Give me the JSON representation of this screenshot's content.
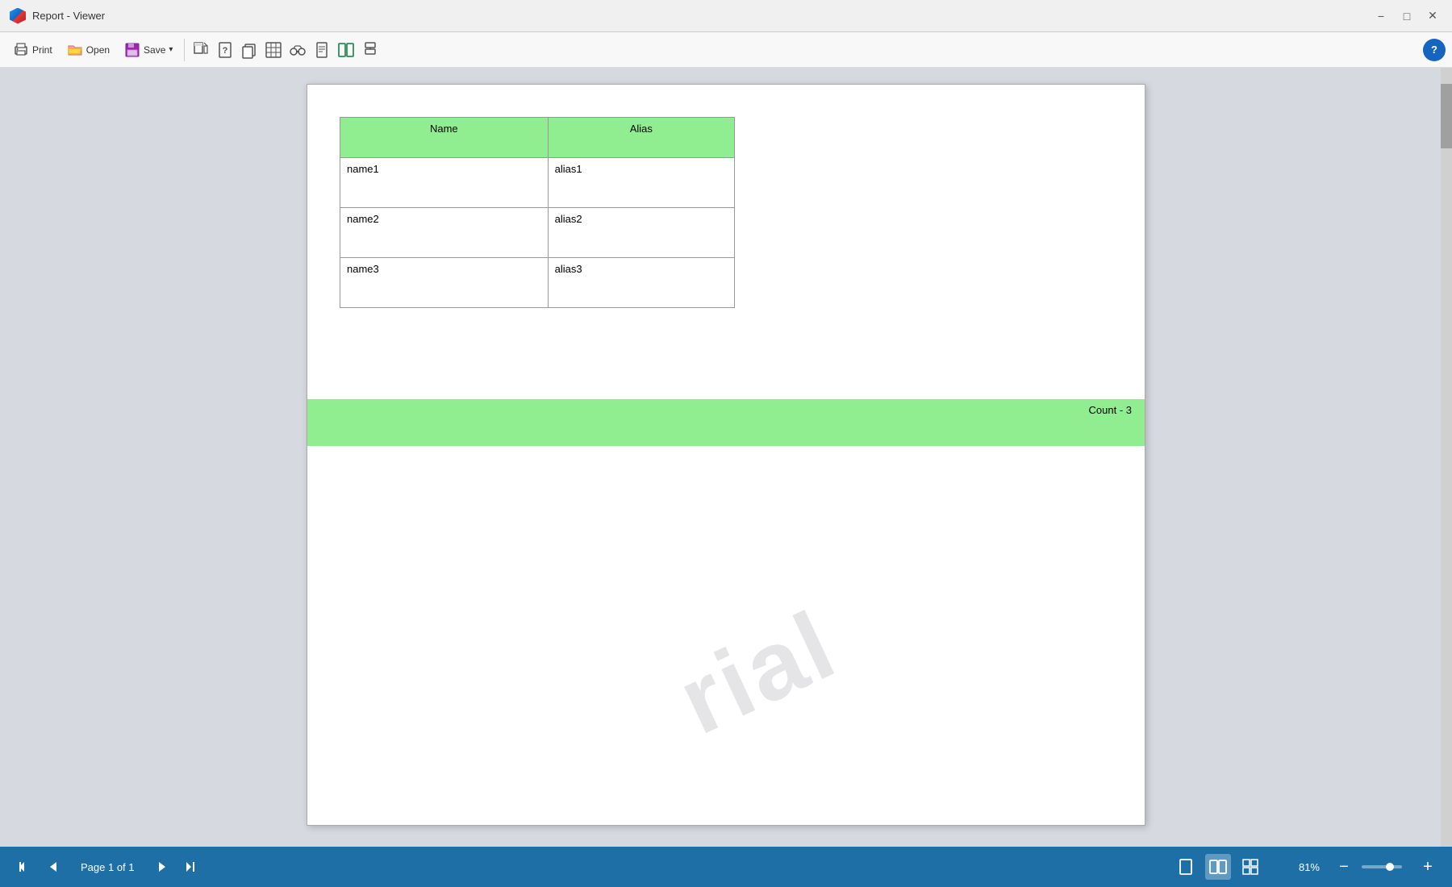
{
  "titleBar": {
    "title": "Report - Viewer",
    "minimizeLabel": "−",
    "maximizeLabel": "□",
    "closeLabel": "✕"
  },
  "toolbar": {
    "printLabel": "Print",
    "openLabel": "Open",
    "saveLabel": "Save",
    "saveArrow": "▾",
    "helpLabel": "?"
  },
  "report": {
    "columns": [
      "Name",
      "Alias"
    ],
    "rows": [
      {
        "name": "name1",
        "alias": "alias1"
      },
      {
        "name": "name2",
        "alias": "alias2"
      },
      {
        "name": "name3",
        "alias": "alias3"
      }
    ],
    "footer": "Count - 3",
    "watermark": "rial"
  },
  "bottomBar": {
    "pageInfo": "Page 1 of 1",
    "zoomLevel": "81%",
    "navFirst": "⏮",
    "navPrev": "◀",
    "navNext": "▶",
    "navLast": "⏭"
  }
}
